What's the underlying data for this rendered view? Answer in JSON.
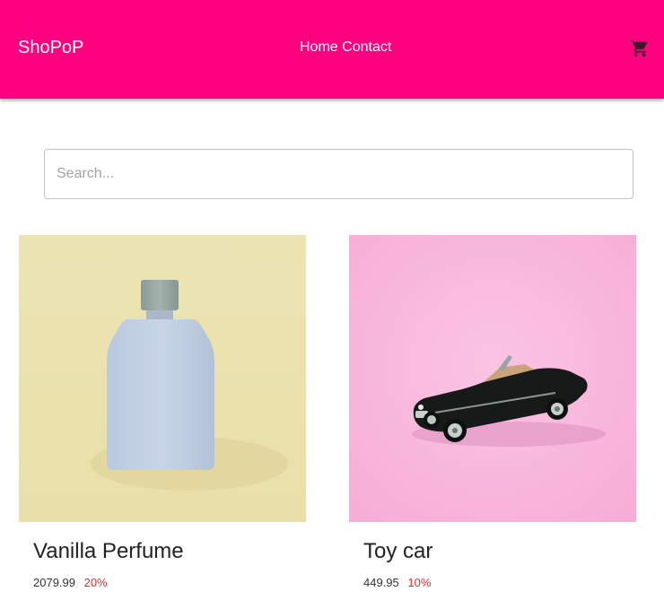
{
  "header": {
    "brand": "ShoPoP",
    "nav": {
      "home": "Home",
      "contact": "Contact"
    },
    "cart_icon": "shopping-cart-icon",
    "background_color": "#ff0080"
  },
  "search": {
    "placeholder": "Search...",
    "value": ""
  },
  "products": [
    {
      "title": "Vanilla Perfume",
      "price": "2079.99",
      "discount": "20%",
      "image": "perfume-bottle-image"
    },
    {
      "title": "Toy car",
      "price": "449.95",
      "discount": "10%",
      "image": "toy-car-image"
    }
  ],
  "colors": {
    "discount": "#d32f2f",
    "perfume_bg": "#ede3b0",
    "toycar_bg": "#f8b6dc"
  }
}
